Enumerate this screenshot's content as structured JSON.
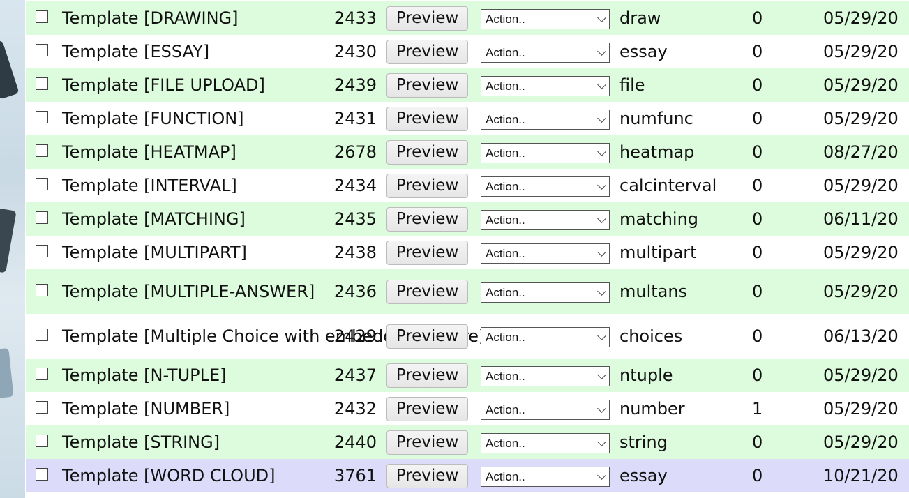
{
  "preview_label": "Preview",
  "action_placeholder": "Action..",
  "rows": [
    {
      "name": "Template [DRAWING]",
      "id": "2433",
      "type": "draw",
      "count": "0",
      "date": "05/29/20"
    },
    {
      "name": "Template [ESSAY]",
      "id": "2430",
      "type": "essay",
      "count": "0",
      "date": "05/29/20"
    },
    {
      "name": "Template [FILE UPLOAD]",
      "id": "2439",
      "type": "file",
      "count": "0",
      "date": "05/29/20"
    },
    {
      "name": "Template [FUNCTION]",
      "id": "2431",
      "type": "numfunc",
      "count": "0",
      "date": "05/29/20"
    },
    {
      "name": "Template [HEATMAP]",
      "id": "2678",
      "type": "heatmap",
      "count": "0",
      "date": "08/27/20"
    },
    {
      "name": "Template [INTERVAL]",
      "id": "2434",
      "type": "calcinterval",
      "count": "0",
      "date": "05/29/20"
    },
    {
      "name": "Template [MATCHING]",
      "id": "2435",
      "type": "matching",
      "count": "0",
      "date": "06/11/20"
    },
    {
      "name": "Template [MULTIPART]",
      "id": "2438",
      "type": "multipart",
      "count": "0",
      "date": "05/29/20"
    },
    {
      "name": "Template [MULTIPLE-ANSWER]",
      "id": "2436",
      "type": "multans",
      "count": "0",
      "date": "05/29/20"
    },
    {
      "name": "Template [Multiple Choice with embedded picture]",
      "id": "2429",
      "type": "choices",
      "count": "0",
      "date": "06/13/20"
    },
    {
      "name": "Template [N-TUPLE]",
      "id": "2437",
      "type": "ntuple",
      "count": "0",
      "date": "05/29/20"
    },
    {
      "name": "Template [NUMBER]",
      "id": "2432",
      "type": "number",
      "count": "1",
      "date": "05/29/20"
    },
    {
      "name": "Template [STRING]",
      "id": "2440",
      "type": "string",
      "count": "0",
      "date": "05/29/20"
    },
    {
      "name": "Template [WORD CLOUD]",
      "id": "3761",
      "type": "essay",
      "count": "0",
      "date": "10/21/20"
    }
  ],
  "colors": {
    "row_even": "#ddfcdd",
    "row_odd": "#ffffff",
    "row_highlight": "#dcdcfa"
  }
}
